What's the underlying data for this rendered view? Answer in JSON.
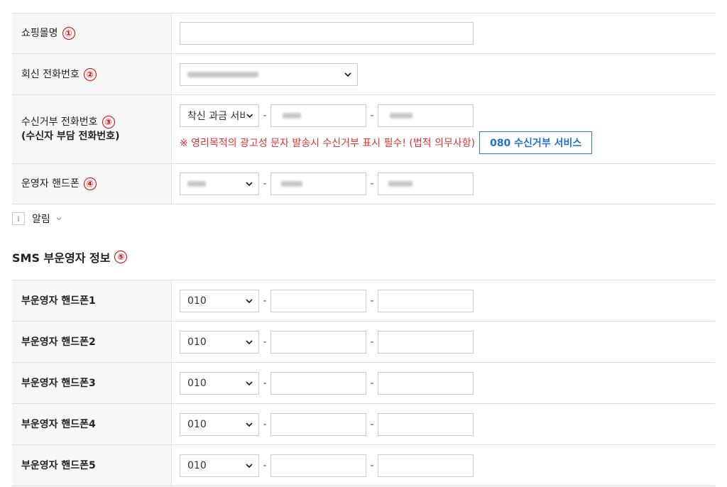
{
  "form1": {
    "shop_name": {
      "label": "쇼핑몰명",
      "marker": "①",
      "value": ""
    },
    "reply_phone": {
      "label": "회신 전화번호",
      "marker": "②"
    },
    "reject_phone": {
      "label": "수신거부 전화번호",
      "label2": "(수신자 부담 전화번호)",
      "marker": "③",
      "select_value": "착신 과금 서비",
      "notice": "※ 영리목적의 광고성 문자 발송시 수신거부 표시 필수! (법적 의무사항)",
      "button": "080 수신거부 서비스"
    },
    "operator_phone": {
      "label": "운영자 핸드폰",
      "marker": "④"
    }
  },
  "alert": {
    "label": "알림",
    "icon": "info-icon"
  },
  "section": {
    "title": "SMS 부운영자 정보",
    "marker": "⑤"
  },
  "sub_operators": [
    {
      "label": "부운영자 핸드폰1",
      "prefix": "010"
    },
    {
      "label": "부운영자 핸드폰2",
      "prefix": "010"
    },
    {
      "label": "부운영자 핸드폰3",
      "prefix": "010"
    },
    {
      "label": "부운영자 핸드폰4",
      "prefix": "010"
    },
    {
      "label": "부운영자 핸드폰5",
      "prefix": "010"
    }
  ],
  "separator": "-"
}
